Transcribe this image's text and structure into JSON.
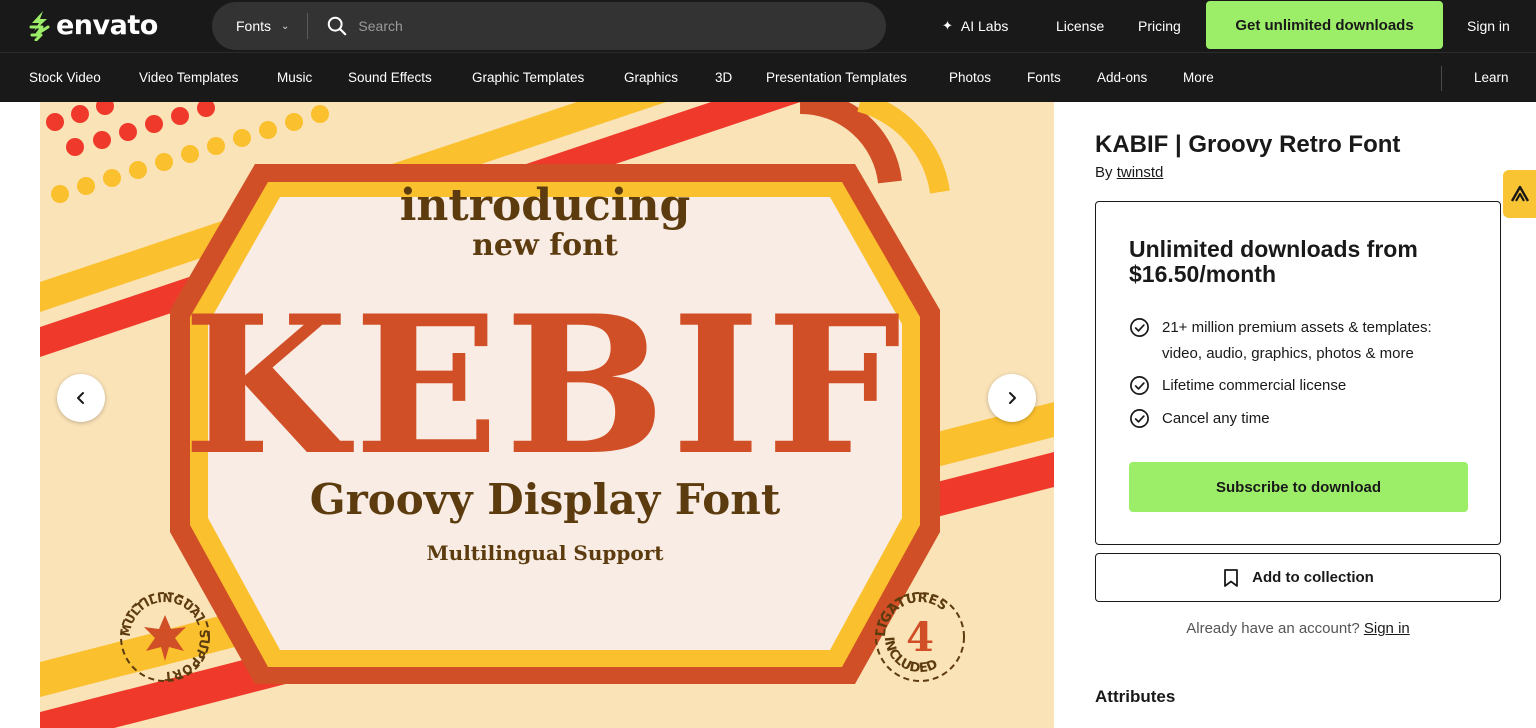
{
  "header": {
    "logo_text": "envato",
    "search": {
      "category": "Fonts",
      "placeholder": "Search"
    },
    "links": {
      "ai_labs": "AI Labs",
      "license": "License",
      "pricing": "Pricing",
      "cta": "Get unlimited downloads",
      "sign_in": "Sign in"
    },
    "cta_color": "#9cee69"
  },
  "categories": [
    "Stock Video",
    "Video Templates",
    "Music",
    "Sound Effects",
    "Graphic Templates",
    "Graphics",
    "3D",
    "Presentation Templates",
    "Photos",
    "Fonts",
    "Add-ons",
    "More"
  ],
  "learn_label": "Learn",
  "preview": {
    "headline_top": "introducing",
    "headline_sub": "new font",
    "font_name": "KEBIF",
    "tagline": "Groovy Display Font",
    "support_line": "Multilingual Support",
    "badge_left": "MULTILINGUAL SUPPORT",
    "badge_right_top": "LIGATURES",
    "badge_right_bottom": "INCLUDED",
    "badge_right_number": "4",
    "colors": {
      "background": "#fbe3b8",
      "orange": "#d14f26",
      "yellow": "#fbc02d",
      "red": "#ef3a2b",
      "brown": "#5c3b0e",
      "panel": "#f8ece4"
    }
  },
  "product": {
    "title": "KABIF | Groovy Retro Font",
    "by_label": "By",
    "author": "twinstd"
  },
  "subscription": {
    "heading": "Unlimited downloads from $16.50/month",
    "features": [
      "21+ million premium assets & templates: video, audio, graphics, photos & more",
      "Lifetime commercial license",
      "Cancel any time"
    ],
    "subscribe_label": "Subscribe to download"
  },
  "collection_label": "Add to collection",
  "account_prompt": "Already have an account?",
  "account_signin": "Sign in",
  "attributes_heading": "Attributes"
}
